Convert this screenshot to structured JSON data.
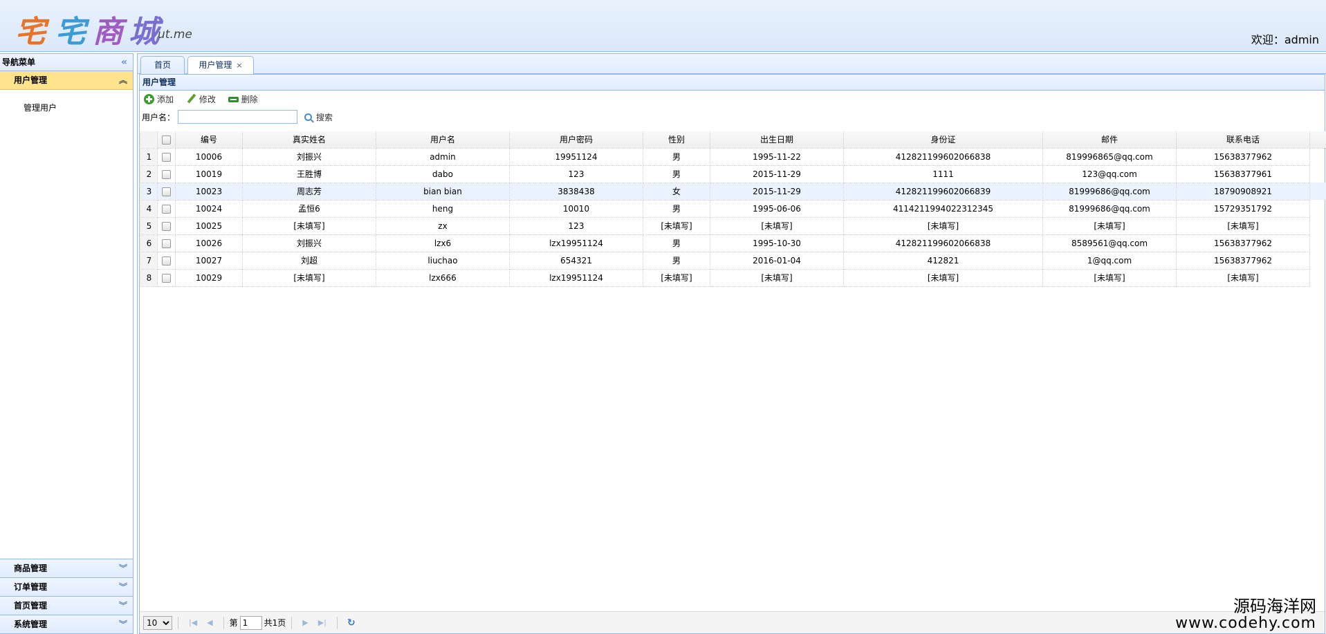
{
  "header": {
    "logo_chars": [
      "宅",
      "宅",
      "商",
      "城"
    ],
    "logo_sub": "ut.me",
    "welcome": "欢迎：admin"
  },
  "sidebar": {
    "title": "导航菜单",
    "active_section": {
      "label": "用户管理",
      "items": [
        "管理用户"
      ]
    },
    "sections": [
      "商品管理",
      "订单管理",
      "首页管理",
      "系统管理"
    ]
  },
  "tabs": [
    {
      "label": "首页",
      "active": false
    },
    {
      "label": "用户管理",
      "active": true,
      "close": "×"
    }
  ],
  "panel": {
    "title": "用户管理",
    "toolbar": {
      "add": "添加",
      "edit": "修改",
      "delete": "删除"
    },
    "search": {
      "label": "用户名：",
      "value": "",
      "button": "搜索"
    }
  },
  "grid": {
    "columns": [
      "编号",
      "真实姓名",
      "用户名",
      "用户密码",
      "性别",
      "出生日期",
      "身份证",
      "邮件",
      "联系电话"
    ],
    "rows": [
      [
        "1",
        "10006",
        "刘振兴",
        "admin",
        "19951124",
        "男",
        "1995-11-22",
        "412821199602066838",
        "819996865@qq.com",
        "15638377962"
      ],
      [
        "2",
        "10019",
        "王胜博",
        "dabo",
        "123",
        "男",
        "2015-11-29",
        "1111",
        "123@qq.com",
        "15638377961"
      ],
      [
        "3",
        "10023",
        "周志芳",
        "bian bian",
        "3838438",
        "女",
        "2015-11-29",
        "412821199602066839",
        "81999686@qq.com",
        "18790908921"
      ],
      [
        "4",
        "10024",
        "孟恒6",
        "heng",
        "10010",
        "男",
        "1995-06-06",
        "4114211994022312345",
        "81999686@qq.com",
        "15729351792"
      ],
      [
        "5",
        "10025",
        "[未填写]",
        "zx",
        "123",
        "[未填写]",
        "[未填写]",
        "[未填写]",
        "[未填写]",
        "[未填写]"
      ],
      [
        "6",
        "10026",
        "刘振兴",
        "lzx6",
        "lzx19951124",
        "男",
        "1995-10-30",
        "412821199602066838",
        "8589561@qq.com",
        "15638377962"
      ],
      [
        "7",
        "10027",
        "刘超",
        "liuchao",
        "654321",
        "男",
        "2016-01-04",
        "412821",
        "1@qq.com",
        "15638377962"
      ],
      [
        "8",
        "10029",
        "[未填写]",
        "lzx666",
        "lzx19951124",
        "[未填写]",
        "[未填写]",
        "[未填写]",
        "[未填写]",
        "[未填写]"
      ]
    ],
    "highlighted_row": 3
  },
  "pager": {
    "page_size": "10",
    "page_prefix": "第",
    "page_value": "1",
    "total": "共1页"
  },
  "watermark": {
    "line1": "源码海洋网",
    "line2": "www.codehy.com"
  }
}
